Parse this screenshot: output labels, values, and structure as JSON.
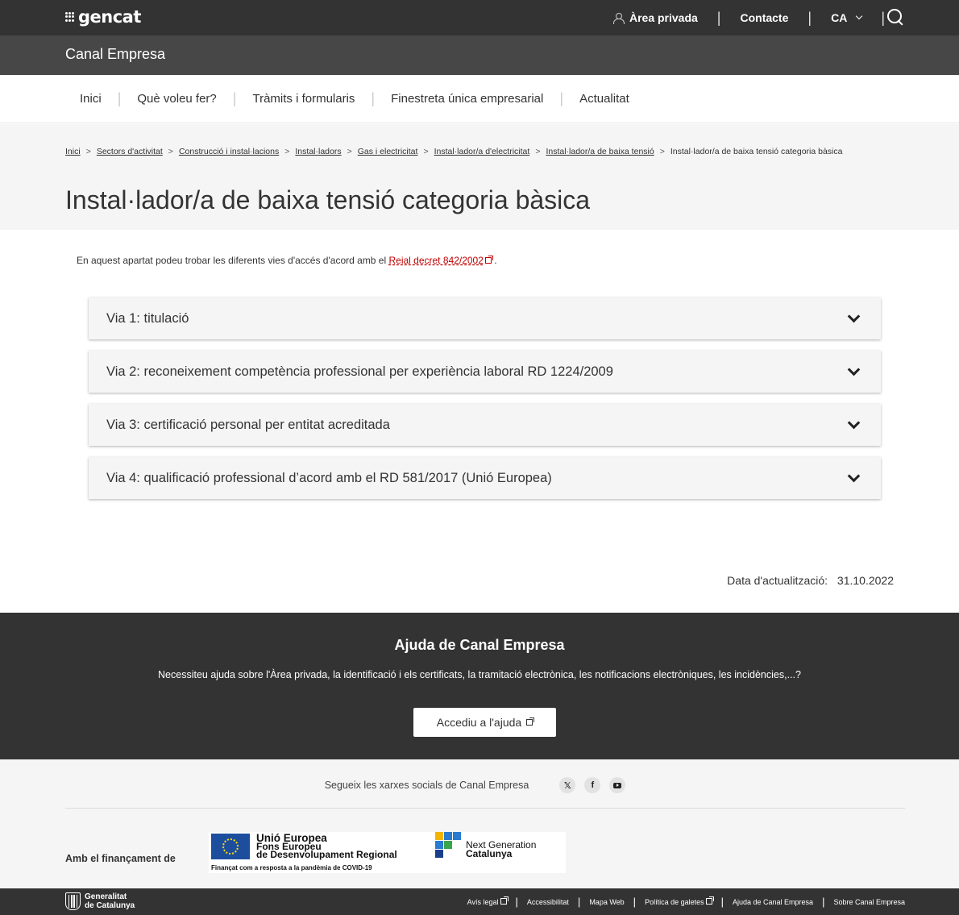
{
  "header": {
    "logo_text": "gencat",
    "area_privada": "Àrea privada",
    "contacte": "Contacte",
    "language": "CA",
    "site_title": "Canal Empresa"
  },
  "nav": {
    "items": [
      {
        "label": "Inici"
      },
      {
        "label": "Què voleu fer?"
      },
      {
        "label": "Tràmits i formularis"
      },
      {
        "label": "Finestreta única empresarial"
      },
      {
        "label": "Actualitat"
      }
    ]
  },
  "breadcrumb": {
    "items": [
      {
        "label": "Inici"
      },
      {
        "label": "Sectors d'activitat"
      },
      {
        "label": "Construcció i instal·lacions"
      },
      {
        "label": "Instal·ladors"
      },
      {
        "label": "Gas i electricitat"
      },
      {
        "label": "Instal·lador/a d'electricitat"
      },
      {
        "label": "Instal·lador/a de baixa tensió"
      }
    ],
    "current": "Instal·lador/a de baixa tensió categoria bàsica"
  },
  "page": {
    "title": "Instal·lador/a de baixa tensió categoria bàsica",
    "intro_text": "En aquest apartat podeu trobar les diferents vies d'accés d'acord amb el ",
    "intro_link": "Reial decret 842/2002",
    "intro_end": "."
  },
  "accordions": [
    {
      "label": "Via 1: titulació"
    },
    {
      "label": "Via 2: reconeixement competència professional per experiència laboral RD 1224/2009"
    },
    {
      "label": "Via 3: certificació personal per entitat acreditada"
    },
    {
      "label": "Via 4: qualificació professional d’acord amb el RD 581/2017 (Unió Europea)"
    }
  ],
  "updated": {
    "label": "Data d'actualització:",
    "date": "31.10.2022"
  },
  "help": {
    "title": "Ajuda de Canal Empresa",
    "text": "Necessiteu ajuda sobre l'Àrea privada, la identificació i els certificats, la tramitació electrònica, les notificacions electròniques, les incidències,...?",
    "button": "Accediu a l'ajuda"
  },
  "social": {
    "text": "Segueix les xarxes socials de Canal Empresa",
    "x_glyph": "𝕏",
    "facebook_glyph": "f"
  },
  "funding": {
    "label": "Amb el finançament de",
    "eu_title": "Unió Europea",
    "eu_line2": "Fons Europeu",
    "eu_line3": "de Desenvolupament Regional",
    "eu_note": "Finançat com a resposta a la pandèmia de COVID-19",
    "ng_line1": "Next Generation",
    "ng_line2": "Catalunya",
    "eu_color": "#1d4e9e"
  },
  "footer": {
    "gen_line1": "Generalitat",
    "gen_line2": "de Catalunya",
    "links": [
      {
        "label": "Avís legal"
      },
      {
        "label": "Accessibilitat"
      },
      {
        "label": "Mapa Web"
      },
      {
        "label": "Política de galetes"
      },
      {
        "label": "Ajuda de Canal Empresa"
      },
      {
        "label": "Sobre Canal Empresa"
      }
    ]
  },
  "colors": {
    "dark_bar": "#333333",
    "site_bar": "#474747",
    "link_red": "#c00000",
    "band_gray": "#f5f5f5"
  }
}
